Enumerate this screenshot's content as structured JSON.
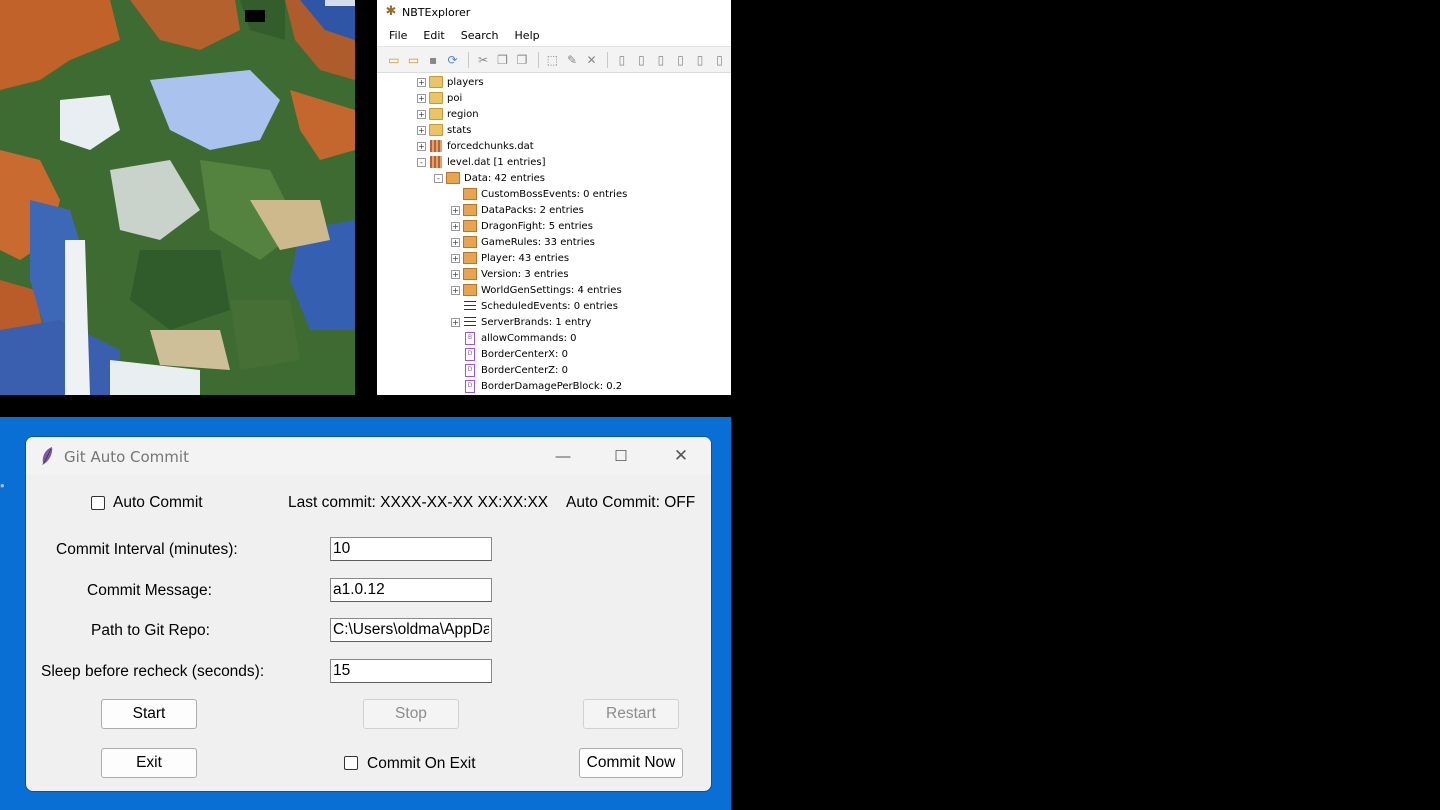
{
  "nbt": {
    "title": "NBTExplorer",
    "menu": [
      "File",
      "Edit",
      "Search",
      "Help"
    ],
    "tree": [
      {
        "label": "players",
        "kind": "folder",
        "depth": 0,
        "expander": "+"
      },
      {
        "label": "poi",
        "kind": "folder",
        "depth": 0,
        "expander": "+"
      },
      {
        "label": "region",
        "kind": "folder",
        "depth": 0,
        "expander": "+"
      },
      {
        "label": "stats",
        "kind": "folder",
        "depth": 0,
        "expander": "+"
      },
      {
        "label": "forcedchunks.dat",
        "kind": "file",
        "depth": 0,
        "expander": "+"
      },
      {
        "label": "level.dat [1 entries]",
        "kind": "file",
        "depth": 0,
        "expander": "-"
      },
      {
        "label": "Data: 42 entries",
        "kind": "compound",
        "depth": 1,
        "expander": "-"
      },
      {
        "label": "CustomBossEvents: 0 entries",
        "kind": "compound",
        "depth": 2,
        "expander": ""
      },
      {
        "label": "DataPacks: 2 entries",
        "kind": "compound",
        "depth": 2,
        "expander": "+"
      },
      {
        "label": "DragonFight: 5 entries",
        "kind": "compound",
        "depth": 2,
        "expander": "+"
      },
      {
        "label": "GameRules: 33 entries",
        "kind": "compound",
        "depth": 2,
        "expander": "+"
      },
      {
        "label": "Player: 43 entries",
        "kind": "compound",
        "depth": 2,
        "expander": "+"
      },
      {
        "label": "Version: 3 entries",
        "kind": "compound",
        "depth": 2,
        "expander": "+"
      },
      {
        "label": "WorldGenSettings: 4 entries",
        "kind": "compound",
        "depth": 2,
        "expander": "+"
      },
      {
        "label": "ScheduledEvents: 0 entries",
        "kind": "list",
        "depth": 2,
        "expander": ""
      },
      {
        "label": "ServerBrands: 1 entry",
        "kind": "list",
        "depth": 2,
        "expander": "+"
      },
      {
        "label": "allowCommands: 0",
        "kind": "tag",
        "tag": "B",
        "depth": 2,
        "expander": ""
      },
      {
        "label": "BorderCenterX: 0",
        "kind": "tag",
        "tag": "D",
        "depth": 2,
        "expander": ""
      },
      {
        "label": "BorderCenterZ: 0",
        "kind": "tag",
        "tag": "D",
        "depth": 2,
        "expander": ""
      },
      {
        "label": "BorderDamagePerBlock: 0.2",
        "kind": "tag",
        "tag": "D",
        "depth": 2,
        "expander": ""
      }
    ]
  },
  "git": {
    "title": "Git Auto Commit",
    "auto_commit_label": "Auto Commit",
    "last_commit": "Last commit: XXXX-XX-XX XX:XX:XX",
    "auto_commit_status": "Auto Commit: OFF",
    "interval_label": "Commit Interval (minutes):",
    "interval_value": "10",
    "message_label": "Commit Message:",
    "message_value": "a1.0.12",
    "path_label": "Path to Git Repo:",
    "path_value": "C:\\Users\\oldma\\AppData",
    "sleep_label": "Sleep before recheck (seconds):",
    "sleep_value": "15",
    "start": "Start",
    "stop": "Stop",
    "restart": "Restart",
    "exit": "Exit",
    "commit_on_exit": "Commit On Exit",
    "commit_now": "Commit Now"
  },
  "colors": {
    "frame_blue": "#0a6fd4",
    "window_bg": "#f0f0f0"
  }
}
